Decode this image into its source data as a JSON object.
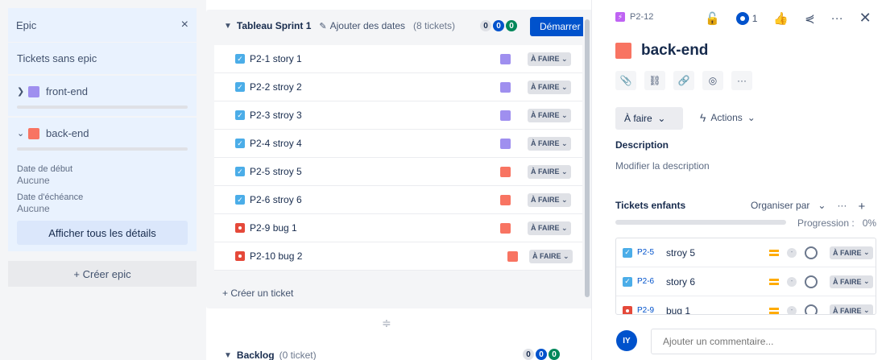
{
  "epic_panel": {
    "title": "Epic",
    "close_icon": "×",
    "no_epic_label": "Tickets sans epic",
    "epics": [
      {
        "name": "front-end",
        "color": "#9f8fef",
        "expanded": false
      },
      {
        "name": "back-end",
        "color": "#f87462",
        "expanded": true
      }
    ],
    "start_date_label": "Date de début",
    "start_date_value": "Aucune",
    "due_date_label": "Date d'échéance",
    "due_date_value": "Aucune",
    "all_details_label": "Afficher tous les détails",
    "create_epic_label": "+ Créer epic"
  },
  "sprint": {
    "title": "Tableau Sprint 1",
    "add_dates_label": "Ajouter des dates",
    "ticket_count": "(8 tickets)",
    "pill_todo": "0",
    "pill_progress": "0",
    "pill_done": "0",
    "start_label": "Démarrer",
    "tickets": [
      {
        "key": "P2-1",
        "summary": "story 1",
        "type": "task",
        "epic_color": "#9f8fef",
        "status": "À FAIRE"
      },
      {
        "key": "P2-2",
        "summary": "stroy 2",
        "type": "task",
        "epic_color": "#9f8fef",
        "status": "À FAIRE"
      },
      {
        "key": "P2-3",
        "summary": "stroy 3",
        "type": "task",
        "epic_color": "#9f8fef",
        "status": "À FAIRE"
      },
      {
        "key": "P2-4",
        "summary": "stroy 4",
        "type": "task",
        "epic_color": "#9f8fef",
        "status": "À FAIRE"
      },
      {
        "key": "P2-5",
        "summary": "stroy 5",
        "type": "task",
        "epic_color": "#f87462",
        "status": "À FAIRE"
      },
      {
        "key": "P2-6",
        "summary": "stroy 6",
        "type": "task",
        "epic_color": "#f87462",
        "status": "À FAIRE"
      },
      {
        "key": "P2-9",
        "summary": "bug 1",
        "type": "bug",
        "epic_color": "#f87462",
        "status": "À FAIRE"
      },
      {
        "key": "P2-10",
        "summary": "bug 2",
        "type": "bug",
        "epic_color": "#f87462",
        "status": "À FAIRE"
      }
    ],
    "create_ticket_label": "+ Créer un ticket"
  },
  "backlog": {
    "title": "Backlog",
    "count": "(0 ticket)",
    "pill_todo": "0",
    "pill_progress": "0",
    "pill_done": "0"
  },
  "detail": {
    "key": "P2-12",
    "watch_count": "1",
    "title": "back-end",
    "color": "#f87462",
    "status_label": "À faire",
    "actions_label": "Actions",
    "description_label": "Description",
    "description_edit": "Modifier la description",
    "children_label": "Tickets enfants",
    "organise_label": "Organiser par",
    "progress_label": "Progression :",
    "progress_value": "0%",
    "children": [
      {
        "key": "P2-5",
        "summary": "stroy 5",
        "type": "task",
        "status": "À FAIRE",
        "estimate": "-"
      },
      {
        "key": "P2-6",
        "summary": "story 6",
        "type": "task",
        "status": "À FAIRE",
        "estimate": "-"
      },
      {
        "key": "P2-9",
        "summary": "bug 1",
        "type": "bug",
        "status": "À FAIRE",
        "estimate": "-"
      }
    ],
    "avatar_initials": "IY",
    "comment_placeholder": "Ajouter un commentaire..."
  }
}
